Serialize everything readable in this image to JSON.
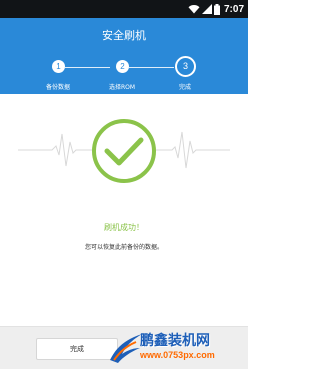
{
  "status_bar": {
    "time": "7:07"
  },
  "header": {
    "title": "安全刷机"
  },
  "steps": [
    {
      "number": "1",
      "label": "备份数据"
    },
    {
      "number": "2",
      "label": "选择ROM"
    },
    {
      "number": "3",
      "label": "完成"
    }
  ],
  "result": {
    "title": "刷机成功！",
    "description": "您可以恢复此前备份的数据。"
  },
  "bottom": {
    "done_label": "完成"
  },
  "watermark": {
    "title": "鹏鑫装机网",
    "url": "www.0753px.com"
  },
  "colors": {
    "accent": "#2a89d8",
    "success": "#8bc34a",
    "status_bar": "#111417"
  },
  "icons": [
    "wifi-icon",
    "signal-icon",
    "battery-icon",
    "checkmark-icon",
    "heartbeat-line"
  ]
}
